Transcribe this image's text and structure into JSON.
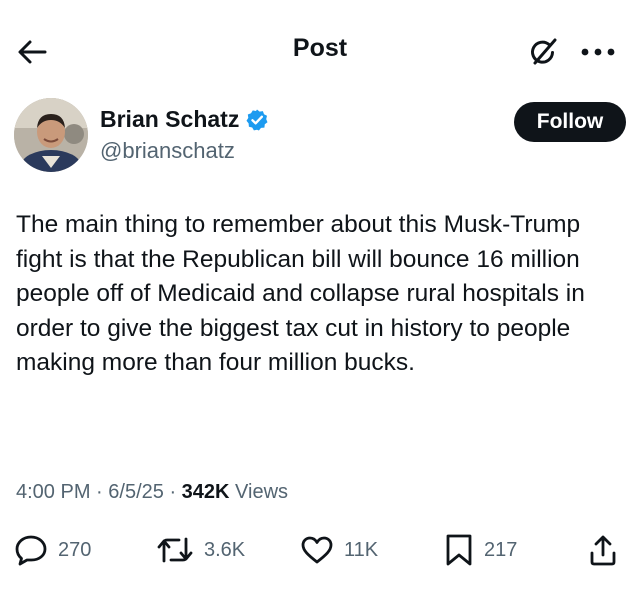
{
  "header": {
    "title": "Post",
    "back_icon": "arrow-left-icon",
    "grok_icon": "grok-icon",
    "more_icon": "more-horizontal-icon"
  },
  "author": {
    "name": "Brian Schatz",
    "handle": "@brianschatz",
    "verified": true,
    "verified_color": "#1d9bf0",
    "follow_label": "Follow"
  },
  "post": {
    "text": "The main thing to remember about this Musk-Trump fight is that the Republican bill will bounce 16 million people off of Medicaid and collapse rural hospitals in order to give the biggest tax cut in history to people making more than four million bucks.",
    "time": "4:00 PM",
    "date": "6/5/25",
    "views_count": "342K",
    "views_label": "Views"
  },
  "actions": {
    "replies": "270",
    "reposts": "3.6K",
    "likes": "11K",
    "bookmarks": "217"
  },
  "colors": {
    "text": "#0f1419",
    "secondary": "#536471",
    "accent": "#1d9bf0"
  }
}
